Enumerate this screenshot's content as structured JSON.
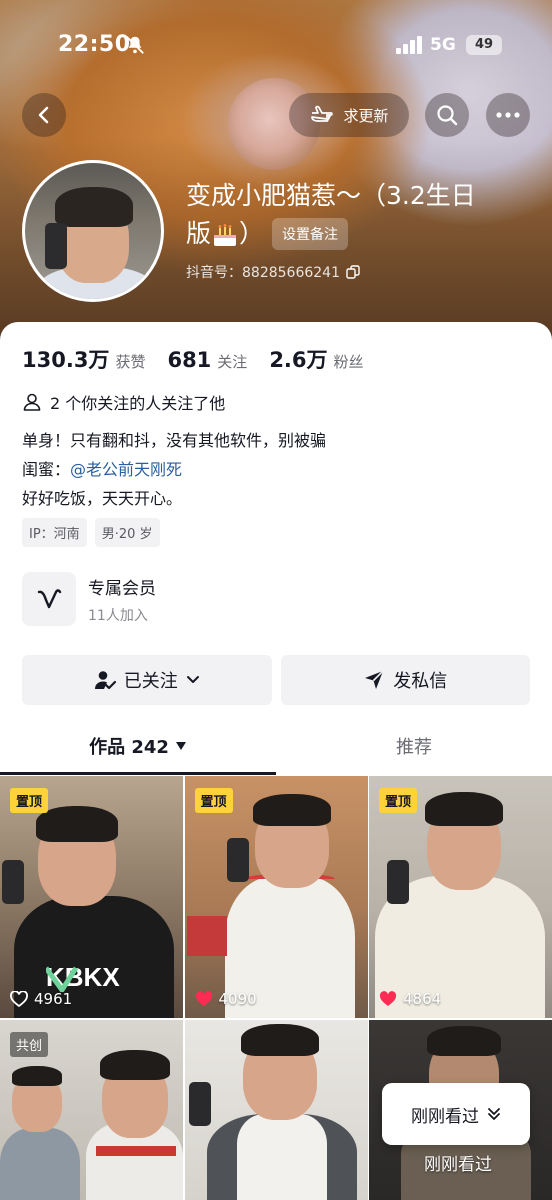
{
  "status_bar": {
    "time": "22:50",
    "network": "5G",
    "battery": "49"
  },
  "header": {
    "request_update_label": "求更新"
  },
  "profile": {
    "name_line1": "变成小肥猫惹～（3.2生日",
    "name_line2": "版",
    "name_line2_end": "）",
    "remark_label": "设置备注",
    "douyin_id": "抖音号：88285666241"
  },
  "stats": [
    {
      "value": "130.3万",
      "label": "获赞"
    },
    {
      "value": "681",
      "label": "关注"
    },
    {
      "value": "2.6万",
      "label": "粉丝"
    }
  ],
  "mutual_follow": "2 个你关注的人关注了他",
  "bio": {
    "line1": "单身！只有翻和抖，没有其他软件，别被骗",
    "line2_prefix": "闺蜜：",
    "line2_mention": "@老公前天刚死",
    "line3": "好好吃饭，天天开心。"
  },
  "tags": [
    "IP：河南",
    "男·20 岁"
  ],
  "membership": {
    "title": "专属会员",
    "subtitle": "11人加入"
  },
  "actions": {
    "follow_label": "已关注",
    "message_label": "发私信"
  },
  "tabs": {
    "works": "作品 242",
    "recommend": "推荐"
  },
  "videos": [
    {
      "badge": "置顶",
      "likes": "4961",
      "liked": false
    },
    {
      "badge": "置顶",
      "likes": "4090",
      "liked": true
    },
    {
      "badge": "置顶",
      "likes": "4864",
      "liked": true
    },
    {
      "badge": "共创"
    },
    {
      "badge": ""
    },
    {
      "badge": ""
    }
  ],
  "recently_viewed": {
    "popup_label": "刚刚看过",
    "overlay_label": "刚刚看过"
  },
  "colors": {
    "pin_badge": "#fed23b",
    "like_heart": "#fe2c55",
    "mention": "#2a5f9e"
  }
}
